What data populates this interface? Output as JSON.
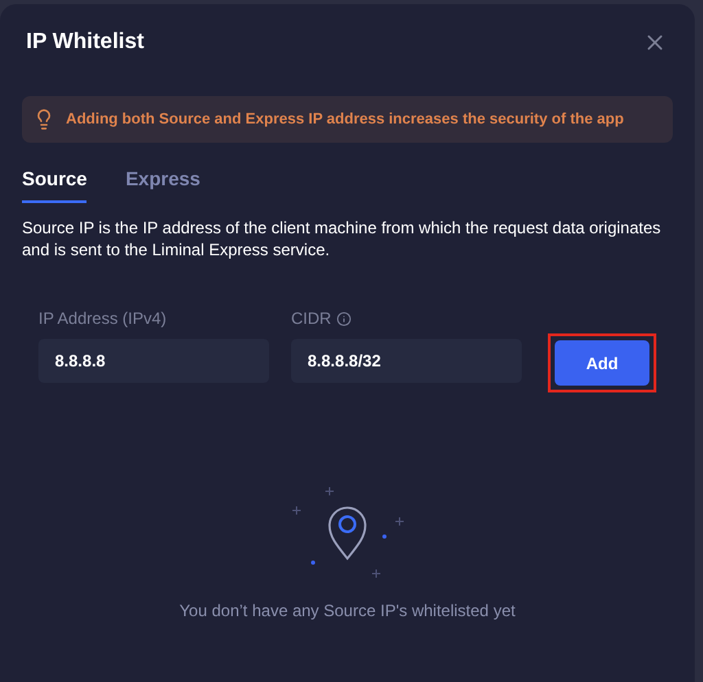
{
  "dialog": {
    "title": "IP Whitelist"
  },
  "alert": {
    "text": "Adding both Source and Express IP address increases the security of the app"
  },
  "tabs": [
    {
      "label": "Source",
      "selected": true
    },
    {
      "label": "Express",
      "selected": false
    }
  ],
  "description": "Source IP is the IP address of the client machine from which the request data originates and is sent to the Liminal Express service.",
  "fields": [
    {
      "label": "IP Address (IPv4)",
      "value": "8.8.8.8",
      "info": false
    },
    {
      "label": "CIDR",
      "value": "8.8.8.8/32",
      "info": true
    }
  ],
  "add_button": {
    "label": "Add",
    "highlighted": true
  },
  "empty_state": {
    "text": "You don’t have any Source IP's whitelisted yet"
  }
}
